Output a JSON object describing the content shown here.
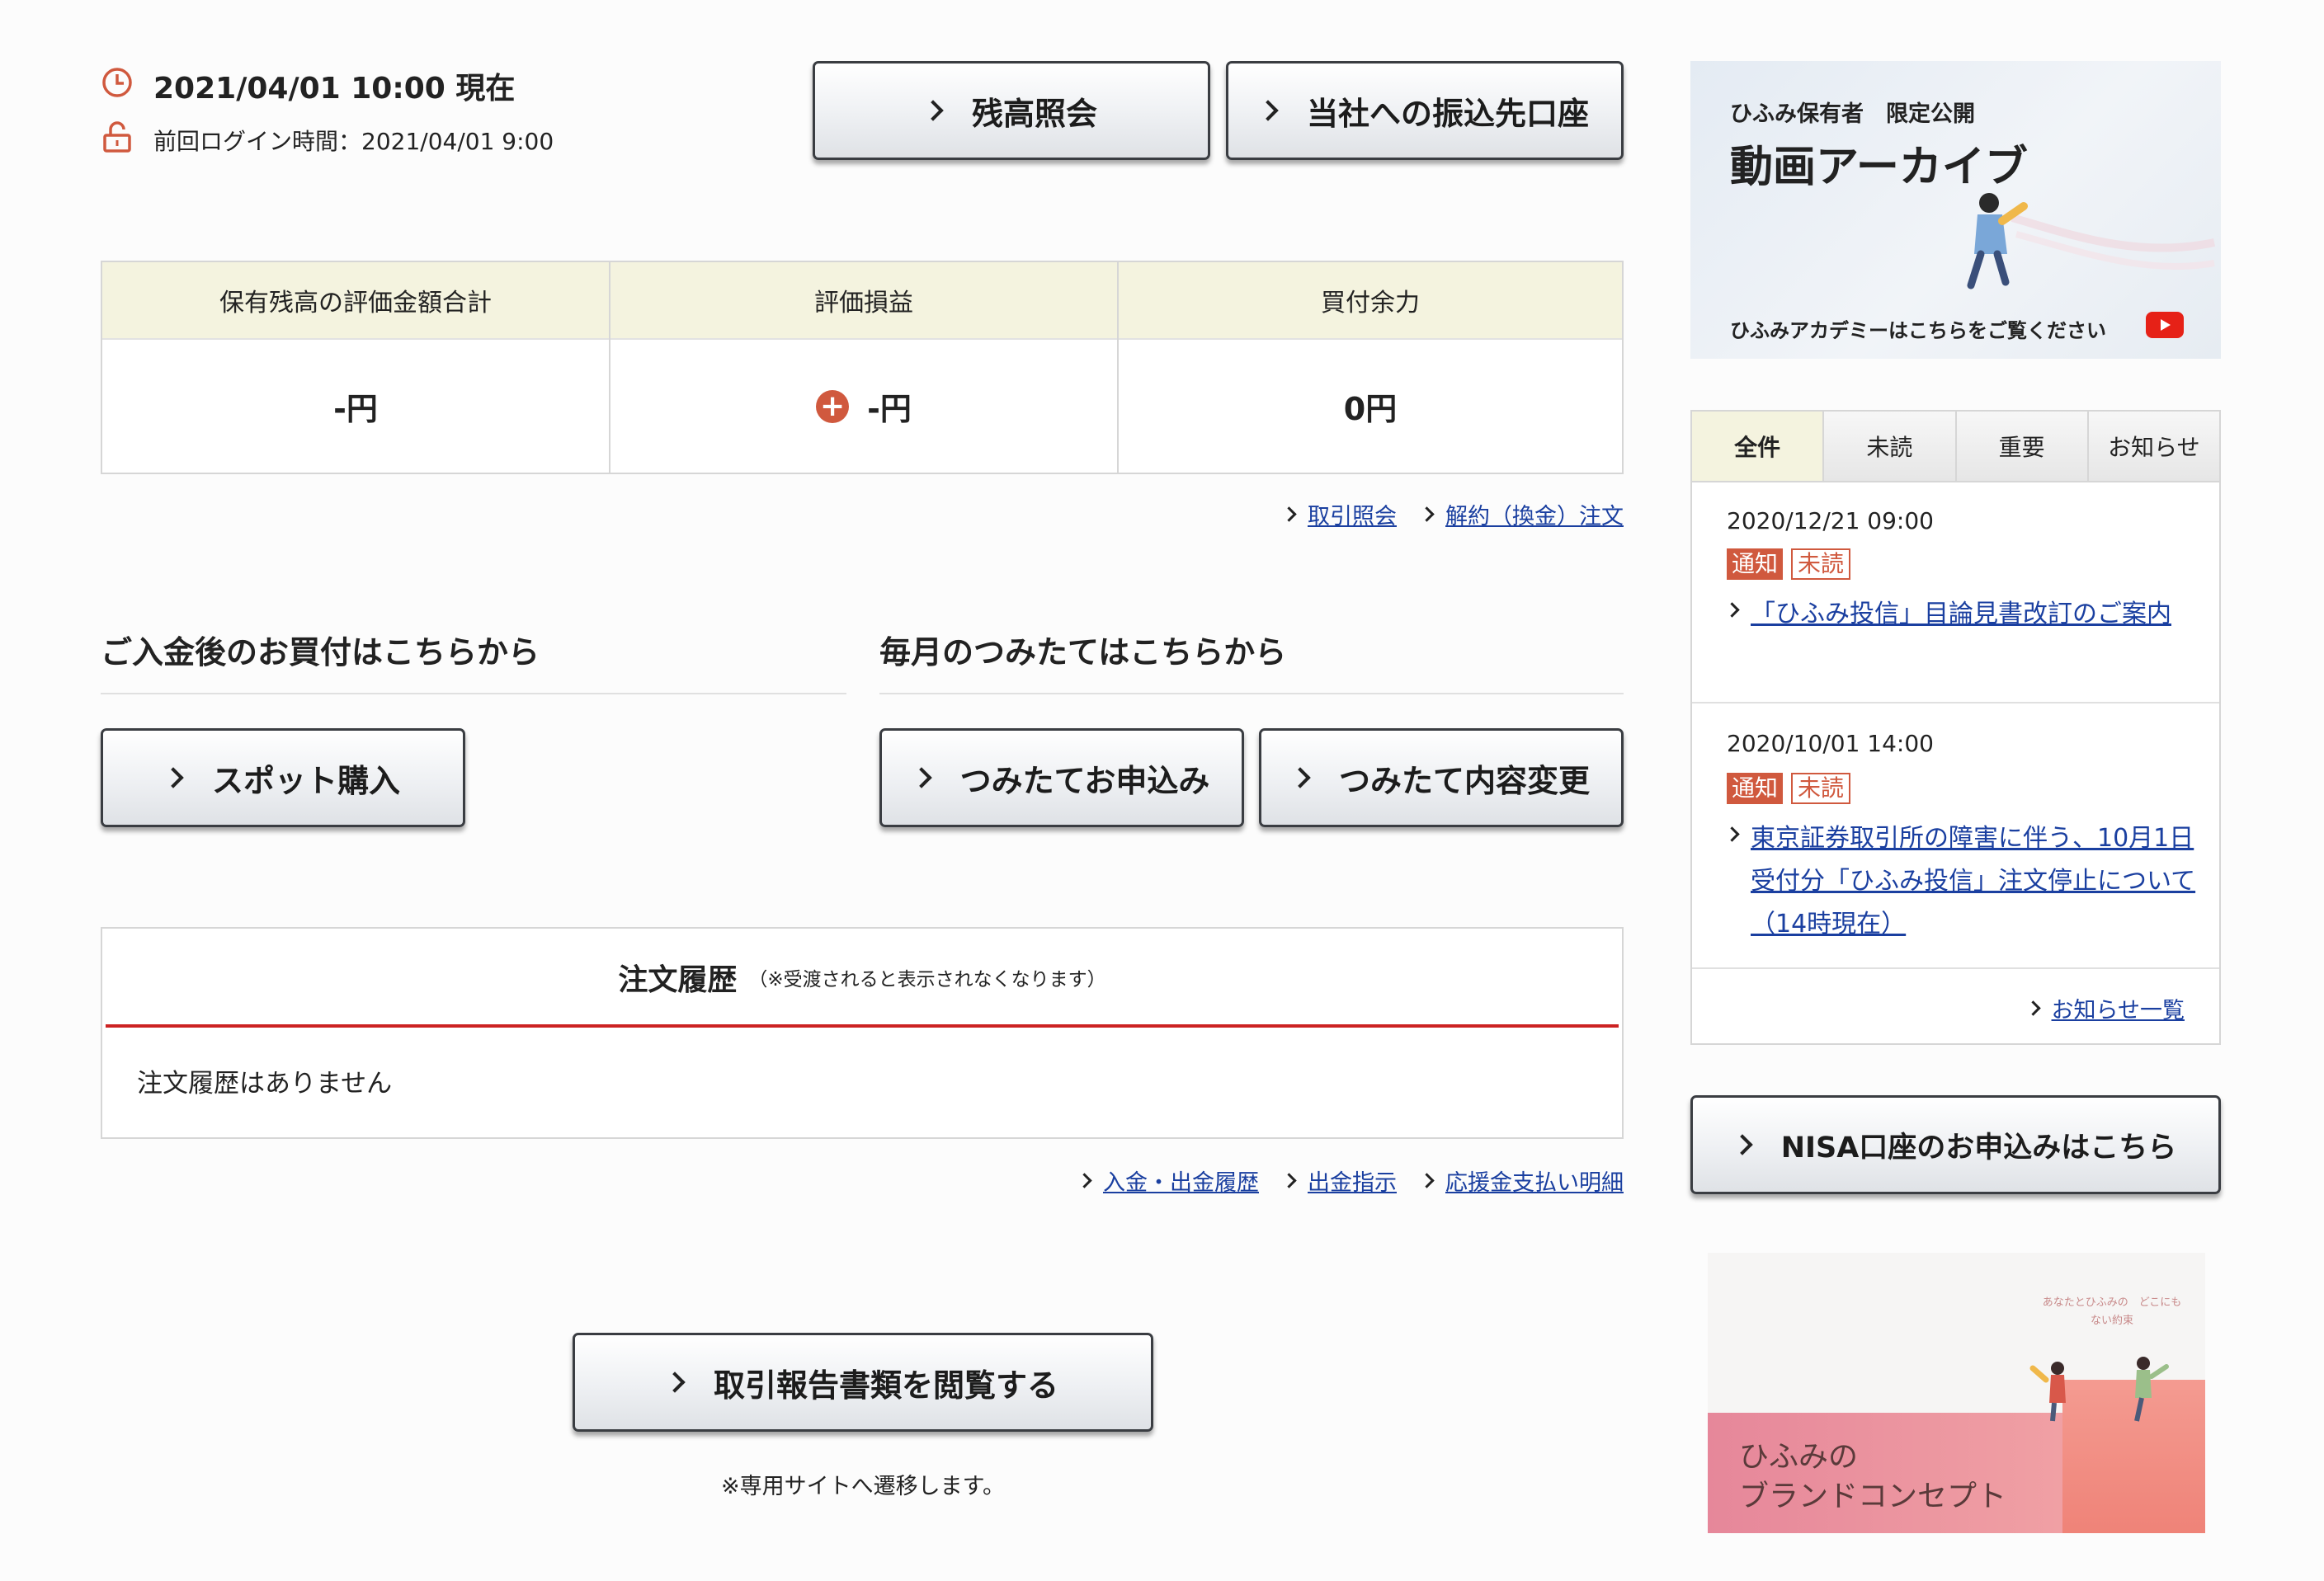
{
  "header": {
    "datetime": "2021/04/01 10:00 現在",
    "last_login": "前回ログイン時間：2021/04/01 9:00",
    "clock_icon": "clock-icon",
    "lock_icon": "unlock-icon",
    "accent_color": "#d0593e"
  },
  "top_buttons": {
    "balance": "残高照会",
    "transfer_account": "当社への振込先口座"
  },
  "summary": {
    "headers": [
      "保有残高の評価金額合計",
      "評価損益",
      "買付余力"
    ],
    "values": [
      "-円",
      "-円",
      "0円"
    ],
    "plus_icon": "+"
  },
  "summary_links": [
    "取引照会",
    "解約（換金）注文"
  ],
  "sections": {
    "spot_title": "ご入金後のお買付はこちらから",
    "monthly_title": "毎月のつみたてはこちらから",
    "spot_button": "スポット購入",
    "apply_button": "つみたてお申込み",
    "change_button": "つみたて内容変更"
  },
  "orders": {
    "title": "注文履歴",
    "note": "（※受渡されると表示されなくなります）",
    "empty": "注文履歴はありません"
  },
  "bottom_links": [
    "入金・出金履歴",
    "出金指示",
    "応援金支払い明細"
  ],
  "report": {
    "button": "取引報告書類を閲覧する",
    "note": "※専用サイトへ遷移します。"
  },
  "banner_archive": {
    "subtitle": "ひふみ保有者　限定公開",
    "title": "動画アーカイブ",
    "footer": "ひふみアカデミーはこちらをご覧ください"
  },
  "news": {
    "tabs": [
      "全件",
      "未読",
      "重要",
      "お知らせ"
    ],
    "items": [
      {
        "date": "2020/12/21 09:00",
        "tag1": "通知",
        "tag2": "未読",
        "title": "「ひふみ投信」目論見書改訂のご案内"
      },
      {
        "date": "2020/10/01 14:00",
        "tag1": "通知",
        "tag2": "未読",
        "title": "東京証券取引所の障害に伴う、10月1日受付分「ひふみ投信」注文停止について（14時現在）"
      }
    ],
    "list_link": "お知らせ一覧"
  },
  "nisa_button": "NISA口座のお申込みはこちら",
  "brand_banner": {
    "small_text": "あなたとひふみの　どこにもない約束",
    "title_line1": "ひふみの",
    "title_line2": "ブランドコンセプト"
  }
}
